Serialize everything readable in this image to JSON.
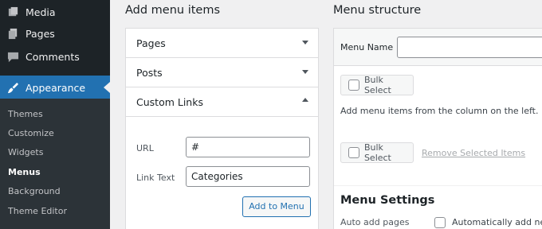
{
  "sidebar": {
    "items": [
      {
        "label": "Media",
        "icon": "media-icon"
      },
      {
        "label": "Pages",
        "icon": "pages-icon"
      },
      {
        "label": "Comments",
        "icon": "comments-icon"
      },
      {
        "label": "Appearance",
        "icon": "appearance-icon"
      }
    ],
    "submenu": [
      "Themes",
      "Customize",
      "Widgets",
      "Menus",
      "Background",
      "Theme Editor"
    ],
    "current_submenu": "Menus"
  },
  "add_menu_items": {
    "heading": "Add menu items",
    "sections": [
      {
        "title": "Pages",
        "expanded": false
      },
      {
        "title": "Posts",
        "expanded": false
      },
      {
        "title": "Custom Links",
        "expanded": true
      }
    ],
    "custom_links": {
      "url_label": "URL",
      "url_value": "#",
      "link_text_label": "Link Text",
      "link_text_value": "Categories",
      "add_button": "Add to Menu"
    }
  },
  "menu_structure": {
    "heading": "Menu structure",
    "menu_name_label": "Menu Name",
    "menu_name_value": "",
    "bulk_select_label": "Bulk Select",
    "instructions": "Add menu items from the column on the left.",
    "remove_selected_label": "Remove Selected Items",
    "settings_heading": "Menu Settings",
    "auto_add_label": "Auto add pages",
    "auto_add_text": "Automatically add new"
  },
  "colors": {
    "sidebar_bg": "#1d2327",
    "accent": "#2271b1"
  }
}
